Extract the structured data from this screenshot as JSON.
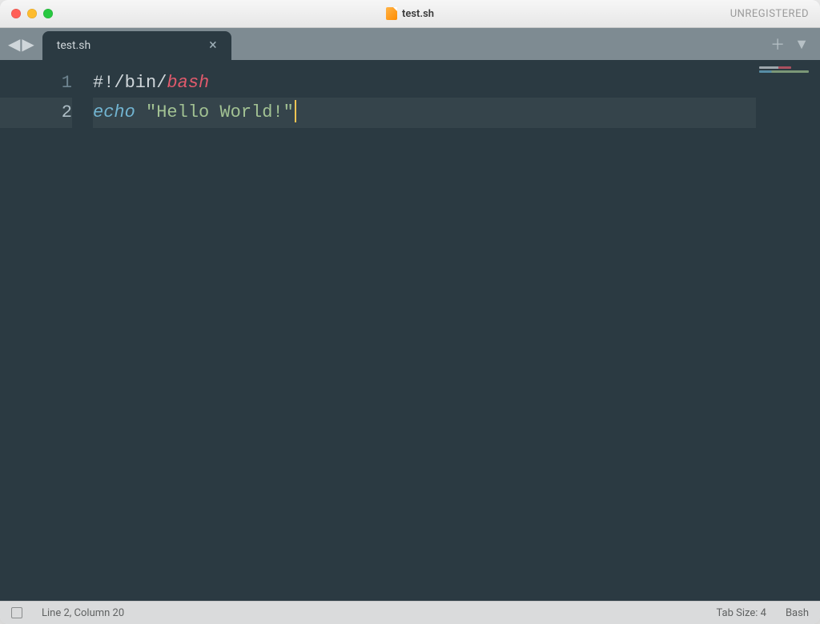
{
  "titlebar": {
    "filename": "test.sh",
    "registration": "UNREGISTERED"
  },
  "tabs": {
    "active": {
      "label": "test.sh"
    }
  },
  "editor": {
    "lines": [
      {
        "num": "1",
        "segments": [
          {
            "cls": "tok-comment",
            "text": "#!/bin/"
          },
          {
            "cls": "tok-shebang-keyword",
            "text": "bash"
          }
        ]
      },
      {
        "num": "2",
        "highlighted": true,
        "cursor_after": true,
        "segments": [
          {
            "cls": "tok-builtin",
            "text": "echo"
          },
          {
            "cls": "",
            "text": " "
          },
          {
            "cls": "tok-string",
            "text": "\"Hello World!\""
          }
        ]
      }
    ]
  },
  "statusbar": {
    "position": "Line 2, Column 20",
    "tabsize": "Tab Size: 4",
    "syntax": "Bash"
  }
}
